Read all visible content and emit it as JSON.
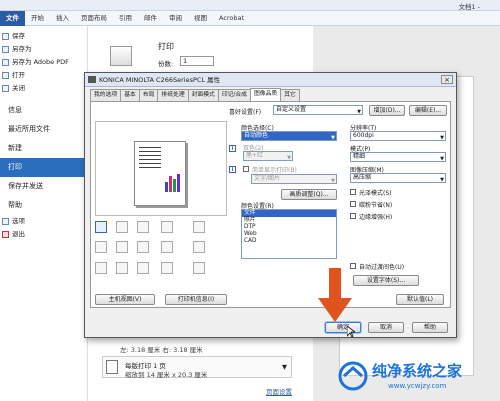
{
  "word": {
    "doc_title": "文档1 -",
    "tabs": [
      "文件",
      "开始",
      "插入",
      "页面布局",
      "引用",
      "邮件",
      "审阅",
      "视图",
      "Acrobat"
    ],
    "left_small": [
      "保存",
      "另存为",
      "另存为 Adobe PDF",
      "打开",
      "关闭"
    ],
    "left_main": [
      "信息",
      "最近所用文件",
      "新建",
      "打印",
      "保存并发送",
      "帮助"
    ],
    "left_bottom": [
      "选项",
      "退出"
    ],
    "print_title": "打印",
    "copies_label": "份数:",
    "copies_value": "1",
    "margins_line": "左: 3.18 厘米   右: 3.18 厘米",
    "pages_per_sheet": "每版打印 1 页",
    "paper_size": "缩放到 14 厘米 x 20.3 厘米",
    "page_setup_link": "页面设置"
  },
  "dialog": {
    "title": "KONICA MINOLTA C266SeriesPCL 属性",
    "tabs": [
      "我的选项",
      "基本",
      "布局",
      "排纸处理",
      "封面模式",
      "印记/合成",
      "图像品质",
      "其它"
    ],
    "selected_tab": "图像品质",
    "favorite_label": "喜好设置(F)",
    "favorite_value": "自定义设置",
    "add_btn": "增加(D)...",
    "edit_btn": "编辑(E)...",
    "color_select_label": "颜色选择(C)",
    "color_select_value": "自动颜色",
    "twocolor_label": "双色(2)",
    "twocolor_value": "黑+红",
    "simple_print_label": "简单显示打印(B)",
    "simple_print_value": "文字/图片",
    "quality_adjust_btn": "画质调整(Q)...",
    "color_settings_label": "颜色设置(R)",
    "color_settings_items": [
      "文件",
      "照片",
      "DTP",
      "Web",
      "CAD"
    ],
    "color_settings_selected": "文件",
    "resolution_label": "分辨率(T)",
    "resolution_value": "600dpi",
    "pattern_label": "模式(P)",
    "pattern_value": "精细",
    "compress_label": "图像压缩(M)",
    "compress_value": "高压缩",
    "gloss_label": "光泽模式(S)",
    "toner_label": "碳粉节省(N)",
    "edge_label": "边缘增强(H)",
    "auto_trap_label": "自动过渡间色(U)",
    "font_settings_btn": "设置字体(S)...",
    "default_btn": "默认值(L)",
    "printer_view_btn": "主机视图(V)",
    "printer_info_btn": "打印机信息(I)",
    "ok_btn": "确定",
    "cancel_btn": "取消",
    "help_btn": "帮助"
  },
  "watermark": {
    "line1": "纯净系统之家",
    "line2": "www.ycwjzy.com"
  },
  "colors": {
    "accent": "#2a6ebd",
    "arrow": "#e0531f"
  }
}
